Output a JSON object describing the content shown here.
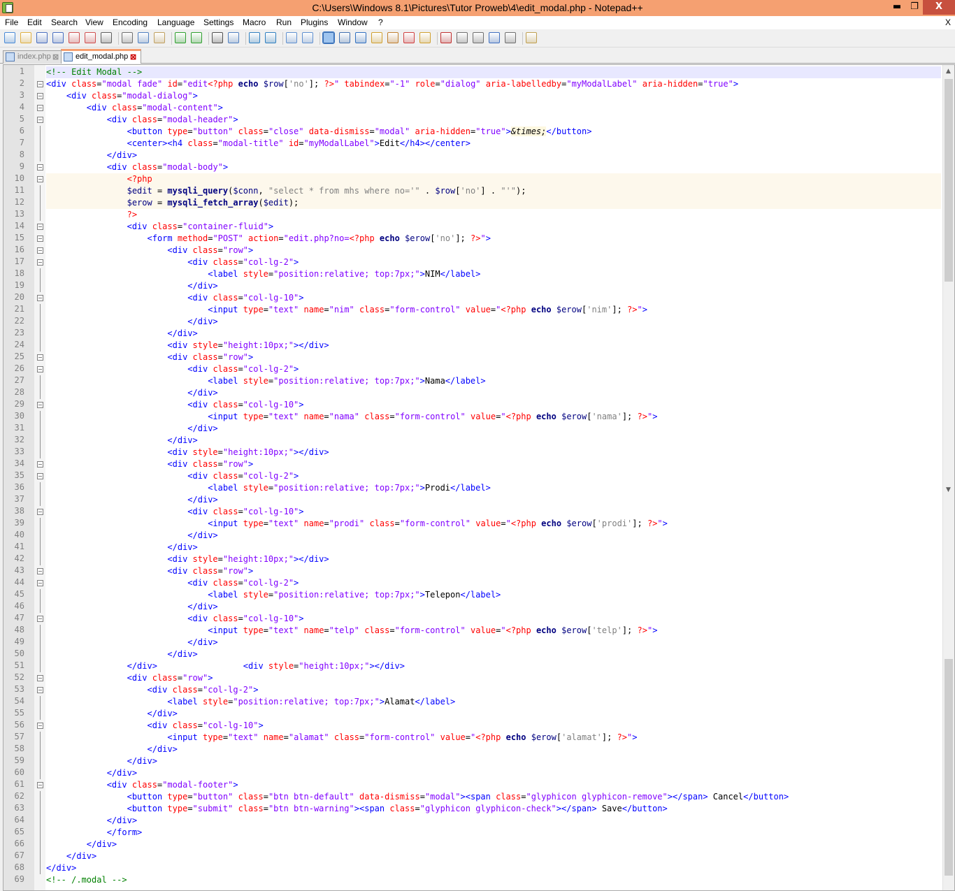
{
  "window": {
    "title": "C:\\Users\\Windows 8.1\\Pictures\\Tutor Proweb\\4\\edit_modal.php - Notepad++",
    "minimize": "▬",
    "restore": "❐",
    "close": "X"
  },
  "menu": [
    "File",
    "Edit",
    "Search",
    "View",
    "Encoding",
    "Language",
    "Settings",
    "Macro",
    "Run",
    "Plugins",
    "Window",
    "?"
  ],
  "menu_close": "X",
  "tabs": [
    {
      "label": "index.php",
      "active": false
    },
    {
      "label": "edit_modal.php",
      "active": true
    }
  ],
  "code_lines": [
    "1",
    "2",
    "3",
    "4",
    "5",
    "6",
    "7",
    "8",
    "9",
    "10",
    "11",
    "12",
    "13",
    "14",
    "15",
    "16",
    "17",
    "18",
    "19",
    "20",
    "21",
    "22",
    "23",
    "24",
    "25",
    "26",
    "27",
    "28",
    "29",
    "30",
    "31",
    "32",
    "33",
    "34",
    "35",
    "36",
    "37",
    "38",
    "39",
    "40",
    "41",
    "42",
    "43",
    "44",
    "45",
    "46",
    "47",
    "48",
    "49",
    "50",
    "51",
    "52",
    "53",
    "54",
    "55",
    "56",
    "57",
    "58",
    "59",
    "60",
    "61",
    "62",
    "63",
    "64",
    "65",
    "66",
    "67",
    "68",
    "69"
  ],
  "code": [
    {
      "i": 0,
      "html": "<span class=\"c\">&lt;!-- Edit Modal --&gt;</span>"
    },
    {
      "i": 0,
      "html": "<span class=\"t\">&lt;div</span> <span class=\"a\">class</span>=<span class=\"s\">\"modal fade\"</span> <span class=\"a\">id</span>=<span class=\"s\">\"edit</span><span class=\"ph2\">&lt;?php</span> <span class=\"pk\">echo</span> <span class=\"p\">$row</span>[<span class=\"ps\">'no'</span>]; <span class=\"ph2\">?&gt;</span><span class=\"s\">\"</span> <span class=\"a\">tabindex</span>=<span class=\"s\">\"-1\"</span> <span class=\"a\">role</span>=<span class=\"s\">\"dialog\"</span> <span class=\"a\">aria-labelledby</span>=<span class=\"s\">\"myModalLabel\"</span> <span class=\"a\">aria-hidden</span>=<span class=\"s\">\"true\"</span><span class=\"t\">&gt;</span>"
    },
    {
      "i": 4,
      "html": "<span class=\"t\">&lt;div</span> <span class=\"a\">class</span>=<span class=\"s\">\"modal-dialog\"</span><span class=\"t\">&gt;</span>"
    },
    {
      "i": 8,
      "html": "<span class=\"t\">&lt;div</span> <span class=\"a\">class</span>=<span class=\"s\">\"modal-content\"</span><span class=\"t\">&gt;</span>"
    },
    {
      "i": 12,
      "html": "<span class=\"t\">&lt;div</span> <span class=\"a\">class</span>=<span class=\"s\">\"modal-header\"</span><span class=\"t\">&gt;</span>"
    },
    {
      "i": 16,
      "html": "<span class=\"t\">&lt;button</span> <span class=\"a\">type</span>=<span class=\"s\">\"button\"</span> <span class=\"a\">class</span>=<span class=\"s\">\"close\"</span> <span class=\"a\">data-dismiss</span>=<span class=\"s\">\"modal\"</span> <span class=\"a\">aria-hidden</span>=<span class=\"s\">\"true\"</span><span class=\"t\">&gt;</span><span class=\"ent\">&amp;times;</span><span class=\"t\">&lt;/button&gt;</span>"
    },
    {
      "i": 16,
      "html": "<span class=\"t\">&lt;center&gt;&lt;h4</span> <span class=\"a\">class</span>=<span class=\"s\">\"modal-title\"</span> <span class=\"a\">id</span>=<span class=\"s\">\"myModalLabel\"</span><span class=\"t\">&gt;</span>Edit<span class=\"t\">&lt;/h4&gt;&lt;/center&gt;</span>"
    },
    {
      "i": 12,
      "html": "<span class=\"t\">&lt;/div&gt;</span>"
    },
    {
      "i": 12,
      "html": "<span class=\"t\">&lt;div</span> <span class=\"a\">class</span>=<span class=\"s\">\"modal-body\"</span><span class=\"t\">&gt;</span>"
    },
    {
      "i": 16,
      "html": "<span class=\"ph2\">&lt;?php</span>",
      "hl": true
    },
    {
      "i": 16,
      "html": "<span class=\"p\">$edit</span> = <span class=\"pk\">mysqli_query</span>(<span class=\"p\">$conn</span>, <span class=\"pd\">\"select * from mhs where no='\"</span> . <span class=\"p\">$row</span>[<span class=\"ps\">'no'</span>] . <span class=\"pd\">\"'\"</span>);",
      "hl": true
    },
    {
      "i": 16,
      "html": "<span class=\"p\">$erow</span> = <span class=\"pk\">mysqli_fetch_array</span>(<span class=\"p\">$edit</span>);",
      "hl": true
    },
    {
      "i": 16,
      "html": "<span class=\"ph2\">?&gt;</span>"
    },
    {
      "i": 16,
      "html": "<span class=\"t\">&lt;div</span> <span class=\"a\">class</span>=<span class=\"s\">\"container-fluid\"</span><span class=\"t\">&gt;</span>"
    },
    {
      "i": 20,
      "html": "<span class=\"t\">&lt;form</span> <span class=\"a\">method</span>=<span class=\"s\">\"POST\"</span> <span class=\"a\">action</span>=<span class=\"s\">\"edit.php?no=</span><span class=\"ph2\">&lt;?php</span> <span class=\"pk\">echo</span> <span class=\"p\">$erow</span>[<span class=\"ps\">'no'</span>]; <span class=\"ph2\">?&gt;</span><span class=\"s\">\"</span><span class=\"t\">&gt;</span>"
    },
    {
      "i": 24,
      "html": "<span class=\"t\">&lt;div</span> <span class=\"a\">class</span>=<span class=\"s\">\"row\"</span><span class=\"t\">&gt;</span>"
    },
    {
      "i": 28,
      "html": "<span class=\"t\">&lt;div</span> <span class=\"a\">class</span>=<span class=\"s\">\"col-lg-2\"</span><span class=\"t\">&gt;</span>"
    },
    {
      "i": 32,
      "html": "<span class=\"t\">&lt;label</span> <span class=\"a\">style</span>=<span class=\"s\">\"position:relative; top:7px;\"</span><span class=\"t\">&gt;</span>NIM<span class=\"t\">&lt;/label&gt;</span>"
    },
    {
      "i": 28,
      "html": "<span class=\"t\">&lt;/div&gt;</span>"
    },
    {
      "i": 28,
      "html": "<span class=\"t\">&lt;div</span> <span class=\"a\">class</span>=<span class=\"s\">\"col-lg-10\"</span><span class=\"t\">&gt;</span>"
    },
    {
      "i": 32,
      "html": "<span class=\"t\">&lt;input</span> <span class=\"a\">type</span>=<span class=\"s\">\"text\"</span> <span class=\"a\">name</span>=<span class=\"s\">\"nim\"</span> <span class=\"a\">class</span>=<span class=\"s\">\"form-control\"</span> <span class=\"a\">value</span>=<span class=\"s\">\"</span><span class=\"ph2\">&lt;?php</span> <span class=\"pk\">echo</span> <span class=\"p\">$erow</span>[<span class=\"ps\">'nim'</span>]; <span class=\"ph2\">?&gt;</span><span class=\"s\">\"</span><span class=\"t\">&gt;</span>"
    },
    {
      "i": 28,
      "html": "<span class=\"t\">&lt;/div&gt;</span>"
    },
    {
      "i": 24,
      "html": "<span class=\"t\">&lt;/div&gt;</span>"
    },
    {
      "i": 24,
      "html": "<span class=\"t\">&lt;div</span> <span class=\"a\">style</span>=<span class=\"s\">\"height:10px;\"</span><span class=\"t\">&gt;&lt;/div&gt;</span>"
    },
    {
      "i": 24,
      "html": "<span class=\"t\">&lt;div</span> <span class=\"a\">class</span>=<span class=\"s\">\"row\"</span><span class=\"t\">&gt;</span>"
    },
    {
      "i": 28,
      "html": "<span class=\"t\">&lt;div</span> <span class=\"a\">class</span>=<span class=\"s\">\"col-lg-2\"</span><span class=\"t\">&gt;</span>"
    },
    {
      "i": 32,
      "html": "<span class=\"t\">&lt;label</span> <span class=\"a\">style</span>=<span class=\"s\">\"position:relative; top:7px;\"</span><span class=\"t\">&gt;</span>Nama<span class=\"t\">&lt;/label&gt;</span>"
    },
    {
      "i": 28,
      "html": "<span class=\"t\">&lt;/div&gt;</span>"
    },
    {
      "i": 28,
      "html": "<span class=\"t\">&lt;div</span> <span class=\"a\">class</span>=<span class=\"s\">\"col-lg-10\"</span><span class=\"t\">&gt;</span>"
    },
    {
      "i": 32,
      "html": "<span class=\"t\">&lt;input</span> <span class=\"a\">type</span>=<span class=\"s\">\"text\"</span> <span class=\"a\">name</span>=<span class=\"s\">\"nama\"</span> <span class=\"a\">class</span>=<span class=\"s\">\"form-control\"</span> <span class=\"a\">value</span>=<span class=\"s\">\"</span><span class=\"ph2\">&lt;?php</span> <span class=\"pk\">echo</span> <span class=\"p\">$erow</span>[<span class=\"ps\">'nama'</span>]; <span class=\"ph2\">?&gt;</span><span class=\"s\">\"</span><span class=\"t\">&gt;</span>"
    },
    {
      "i": 28,
      "html": "<span class=\"t\">&lt;/div&gt;</span>"
    },
    {
      "i": 24,
      "html": "<span class=\"t\">&lt;/div&gt;</span>"
    },
    {
      "i": 24,
      "html": "<span class=\"t\">&lt;div</span> <span class=\"a\">style</span>=<span class=\"s\">\"height:10px;\"</span><span class=\"t\">&gt;&lt;/div&gt;</span>"
    },
    {
      "i": 24,
      "html": "<span class=\"t\">&lt;div</span> <span class=\"a\">class</span>=<span class=\"s\">\"row\"</span><span class=\"t\">&gt;</span>"
    },
    {
      "i": 28,
      "html": "<span class=\"t\">&lt;div</span> <span class=\"a\">class</span>=<span class=\"s\">\"col-lg-2\"</span><span class=\"t\">&gt;</span>"
    },
    {
      "i": 32,
      "html": "<span class=\"t\">&lt;label</span> <span class=\"a\">style</span>=<span class=\"s\">\"position:relative; top:7px;\"</span><span class=\"t\">&gt;</span>Prodi<span class=\"t\">&lt;/label&gt;</span>"
    },
    {
      "i": 28,
      "html": "<span class=\"t\">&lt;/div&gt;</span>"
    },
    {
      "i": 28,
      "html": "<span class=\"t\">&lt;div</span> <span class=\"a\">class</span>=<span class=\"s\">\"col-lg-10\"</span><span class=\"t\">&gt;</span>"
    },
    {
      "i": 32,
      "html": "<span class=\"t\">&lt;input</span> <span class=\"a\">type</span>=<span class=\"s\">\"text\"</span> <span class=\"a\">name</span>=<span class=\"s\">\"prodi\"</span> <span class=\"a\">class</span>=<span class=\"s\">\"form-control\"</span> <span class=\"a\">value</span>=<span class=\"s\">\"</span><span class=\"ph2\">&lt;?php</span> <span class=\"pk\">echo</span> <span class=\"p\">$erow</span>[<span class=\"ps\">'prodi'</span>]; <span class=\"ph2\">?&gt;</span><span class=\"s\">\"</span><span class=\"t\">&gt;</span>"
    },
    {
      "i": 28,
      "html": "<span class=\"t\">&lt;/div&gt;</span>"
    },
    {
      "i": 24,
      "html": "<span class=\"t\">&lt;/div&gt;</span>"
    },
    {
      "i": 24,
      "html": "<span class=\"t\">&lt;div</span> <span class=\"a\">style</span>=<span class=\"s\">\"height:10px;\"</span><span class=\"t\">&gt;&lt;/div&gt;</span>"
    },
    {
      "i": 24,
      "html": "<span class=\"t\">&lt;div</span> <span class=\"a\">class</span>=<span class=\"s\">\"row\"</span><span class=\"t\">&gt;</span>"
    },
    {
      "i": 28,
      "html": "<span class=\"t\">&lt;div</span> <span class=\"a\">class</span>=<span class=\"s\">\"col-lg-2\"</span><span class=\"t\">&gt;</span>"
    },
    {
      "i": 32,
      "html": "<span class=\"t\">&lt;label</span> <span class=\"a\">style</span>=<span class=\"s\">\"position:relative; top:7px;\"</span><span class=\"t\">&gt;</span>Telepon<span class=\"t\">&lt;/label&gt;</span>"
    },
    {
      "i": 28,
      "html": "<span class=\"t\">&lt;/div&gt;</span>"
    },
    {
      "i": 28,
      "html": "<span class=\"t\">&lt;div</span> <span class=\"a\">class</span>=<span class=\"s\">\"col-lg-10\"</span><span class=\"t\">&gt;</span>"
    },
    {
      "i": 32,
      "html": "<span class=\"t\">&lt;input</span> <span class=\"a\">type</span>=<span class=\"s\">\"text\"</span> <span class=\"a\">name</span>=<span class=\"s\">\"telp\"</span> <span class=\"a\">class</span>=<span class=\"s\">\"form-control\"</span> <span class=\"a\">value</span>=<span class=\"s\">\"</span><span class=\"ph2\">&lt;?php</span> <span class=\"pk\">echo</span> <span class=\"p\">$erow</span>[<span class=\"ps\">'telp'</span>]; <span class=\"ph2\">?&gt;</span><span class=\"s\">\"</span><span class=\"t\">&gt;</span>"
    },
    {
      "i": 28,
      "html": "<span class=\"t\">&lt;/div&gt;</span>"
    },
    {
      "i": 24,
      "html": "<span class=\"t\">&lt;/div&gt;</span>"
    },
    {
      "i": 16,
      "html": "<span class=\"t\">&lt;/div&gt;</span>                 <span class=\"t\">&lt;div</span> <span class=\"a\">style</span>=<span class=\"s\">\"height:10px;\"</span><span class=\"t\">&gt;&lt;/div&gt;</span>"
    },
    {
      "i": 16,
      "html": "<span class=\"t\">&lt;div</span> <span class=\"a\">class</span>=<span class=\"s\">\"row\"</span><span class=\"t\">&gt;</span>"
    },
    {
      "i": 20,
      "html": "<span class=\"t\">&lt;div</span> <span class=\"a\">class</span>=<span class=\"s\">\"col-lg-2\"</span><span class=\"t\">&gt;</span>"
    },
    {
      "i": 24,
      "html": "<span class=\"t\">&lt;label</span> <span class=\"a\">style</span>=<span class=\"s\">\"position:relative; top:7px;\"</span><span class=\"t\">&gt;</span>Alamat<span class=\"t\">&lt;/label&gt;</span>"
    },
    {
      "i": 20,
      "html": "<span class=\"t\">&lt;/div&gt;</span>"
    },
    {
      "i": 20,
      "html": "<span class=\"t\">&lt;div</span> <span class=\"a\">class</span>=<span class=\"s\">\"col-lg-10\"</span><span class=\"t\">&gt;</span>"
    },
    {
      "i": 24,
      "html": "<span class=\"t\">&lt;input</span> <span class=\"a\">type</span>=<span class=\"s\">\"text\"</span> <span class=\"a\">name</span>=<span class=\"s\">\"alamat\"</span> <span class=\"a\">class</span>=<span class=\"s\">\"form-control\"</span> <span class=\"a\">value</span>=<span class=\"s\">\"</span><span class=\"ph2\">&lt;?php</span> <span class=\"pk\">echo</span> <span class=\"p\">$erow</span>[<span class=\"ps\">'alamat'</span>]; <span class=\"ph2\">?&gt;</span><span class=\"s\">\"</span><span class=\"t\">&gt;</span>"
    },
    {
      "i": 20,
      "html": "<span class=\"t\">&lt;/div&gt;</span>"
    },
    {
      "i": 16,
      "html": "<span class=\"t\">&lt;/div&gt;</span>"
    },
    {
      "i": 12,
      "html": "<span class=\"t\">&lt;/div&gt;</span>"
    },
    {
      "i": 12,
      "html": "<span class=\"t\">&lt;div</span> <span class=\"a\">class</span>=<span class=\"s\">\"modal-footer\"</span><span class=\"t\">&gt;</span>"
    },
    {
      "i": 16,
      "html": "<span class=\"t\">&lt;button</span> <span class=\"a\">type</span>=<span class=\"s\">\"button\"</span> <span class=\"a\">class</span>=<span class=\"s\">\"btn btn-default\"</span> <span class=\"a\">data-dismiss</span>=<span class=\"s\">\"modal\"</span><span class=\"t\">&gt;&lt;span</span> <span class=\"a\">class</span>=<span class=\"s\">\"glyphicon glyphicon-remove\"</span><span class=\"t\">&gt;&lt;/span&gt;</span> Cancel<span class=\"t\">&lt;/button&gt;</span>"
    },
    {
      "i": 16,
      "html": "<span class=\"t\">&lt;button</span> <span class=\"a\">type</span>=<span class=\"s\">\"submit\"</span> <span class=\"a\">class</span>=<span class=\"s\">\"btn btn-warning\"</span><span class=\"t\">&gt;&lt;span</span> <span class=\"a\">class</span>=<span class=\"s\">\"glyphicon glyphicon-check\"</span><span class=\"t\">&gt;&lt;/span&gt;</span> Save<span class=\"t\">&lt;/button&gt;</span>"
    },
    {
      "i": 12,
      "html": "<span class=\"t\">&lt;/div&gt;</span>"
    },
    {
      "i": 12,
      "html": "<span class=\"t\">&lt;/form&gt;</span>"
    },
    {
      "i": 8,
      "html": "<span class=\"t\">&lt;/div&gt;</span>"
    },
    {
      "i": 4,
      "html": "<span class=\"t\">&lt;/div&gt;</span>"
    },
    {
      "i": 0,
      "html": "<span class=\"t\">&lt;/div&gt;</span>"
    },
    {
      "i": 0,
      "html": "<span class=\"c\">&lt;!-- /.modal --&gt;</span>"
    }
  ],
  "fold_lines": [
    2,
    3,
    4,
    5,
    9,
    10,
    14,
    15,
    16,
    17,
    20,
    25,
    26,
    29,
    34,
    35,
    38,
    43,
    44,
    47,
    52,
    53,
    56,
    61
  ],
  "toolbar_icons": [
    "new-file-icon",
    "open-file-icon",
    "save-icon",
    "save-all-icon",
    "close-icon",
    "close-all-icon",
    "print-icon",
    "cut-icon",
    "copy-icon",
    "paste-icon",
    "undo-icon",
    "redo-icon",
    "find-icon",
    "replace-icon",
    "zoom-in-icon",
    "zoom-out-icon",
    "sync-v-icon",
    "sync-h-icon",
    "word-wrap-icon",
    "show-all-chars-icon",
    "indent-guide-icon",
    "doc-map-icon",
    "function-list-icon",
    "folder-workspace-icon",
    "monitoring-icon",
    "record-macro-icon",
    "stop-macro-icon",
    "play-macro-icon",
    "run-macro-multiple-icon",
    "save-macro-icon",
    "launch-browser-icon"
  ],
  "colors": {
    "title_bar": "#f5a071",
    "tag": "#0000ff",
    "attr": "#ff0000",
    "string": "#8000ff",
    "comment": "#008000"
  }
}
